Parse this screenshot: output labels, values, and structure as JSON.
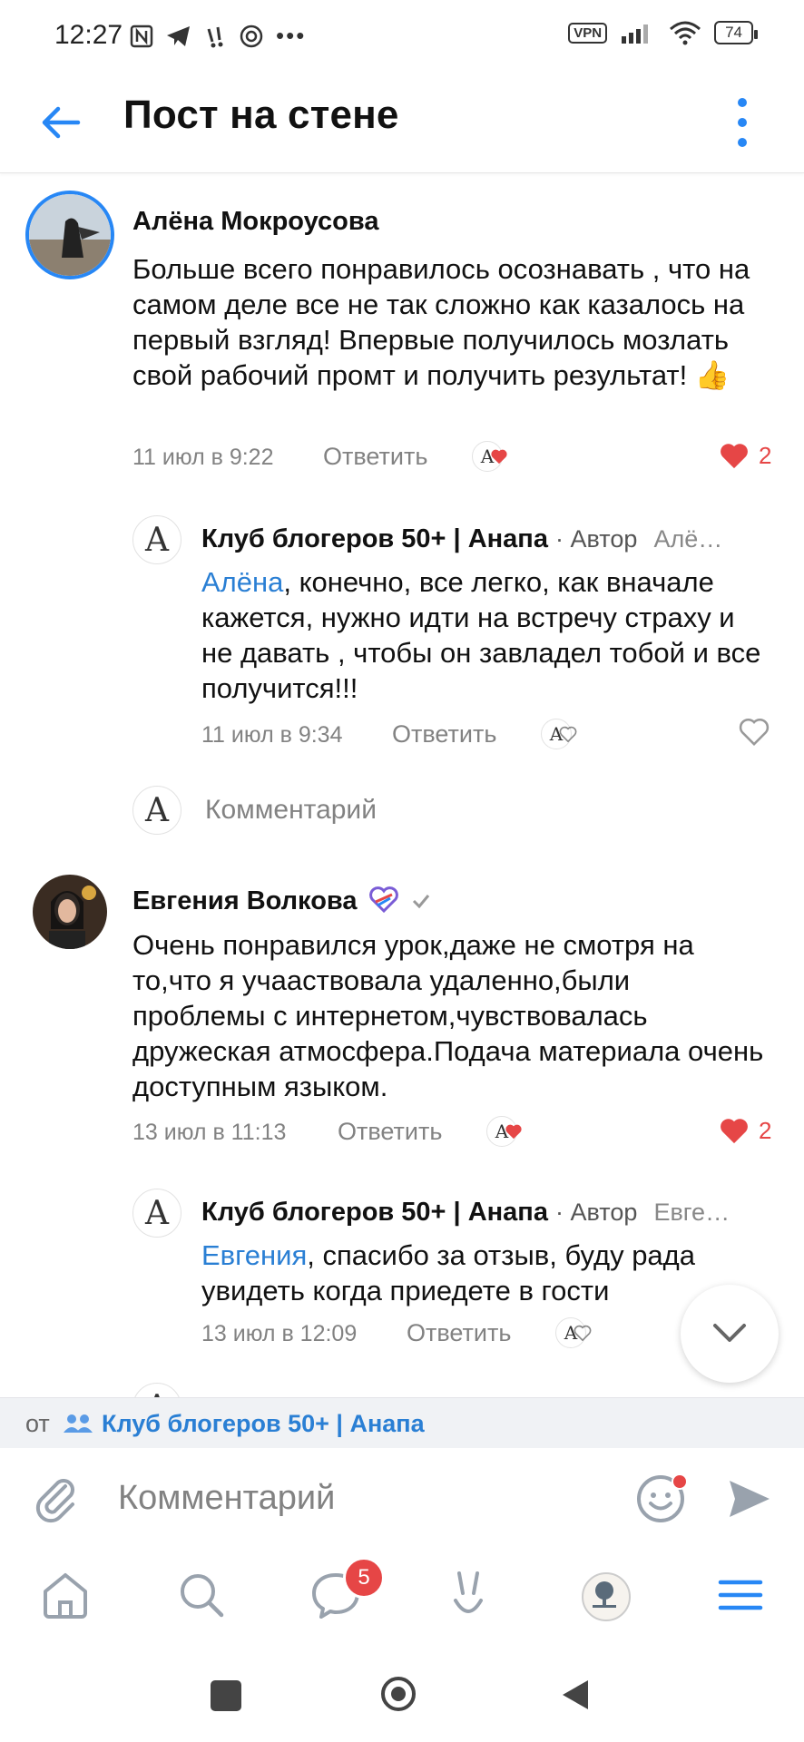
{
  "status_bar": {
    "time": "12:27",
    "vpn": "VPN",
    "battery": "74"
  },
  "header": {
    "title": "Пост на стене"
  },
  "comments": [
    {
      "author": "Алёна Мокроусова",
      "text": "Больше всего понравилось осознавать , что на самом деле все не так сложно как казалось на первый взгляд! Впервые получилось мозлать свой рабочий промт и получить результат!",
      "emoji": "👍",
      "date": "11 июл в 9:22",
      "reply_label": "Ответить",
      "likes": "2"
    },
    {
      "author": "Клуб блогеров 50+ | Анапа",
      "author_tag": "· Автор",
      "reply_to": "Алё…",
      "mention": "Алёна",
      "text": ", конечно, все легко, как вначале кажется, нужно идти на встречу страху и не давать , чтобы он завладел тобой и все получится!!!",
      "date": "11 июл в 9:34",
      "reply_label": "Ответить"
    },
    {
      "comment_placeholder": "Комментарий"
    },
    {
      "author": "Евгения Волкова",
      "text": "Очень понравился урок,даже не смотря на то,что я учааствовала удаленно,были проблемы с интернетом,чувствовалась дружеская атмосфера.Подача материала очень доступным языком.",
      "date": "13 июл в 11:13",
      "reply_label": "Ответить",
      "likes": "2"
    },
    {
      "author": "Клуб блогеров 50+ | Анапа",
      "author_tag": "· Автор",
      "reply_to": "Евге…",
      "mention": "Евгения",
      "text": ", спасибо за отзыв, буду рада увидеть когда приедете в гости",
      "date": "13 июл в 12:09",
      "reply_label": "Ответить"
    }
  ],
  "from_strip": {
    "label": "от",
    "group": "Клуб блогеров 50+ | Анапа"
  },
  "composer": {
    "placeholder": "Комментарий"
  },
  "bottom_nav": {
    "messages_badge": "5"
  },
  "colors": {
    "accent": "#2787f5",
    "link": "#2a7fd4",
    "like_red": "#e64646",
    "secondary_text": "#828282"
  }
}
